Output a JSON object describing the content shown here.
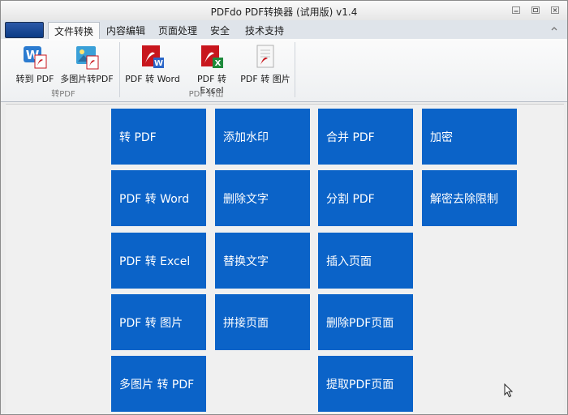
{
  "window": {
    "title": "PDFdo  PDF转换器 (试用版) v1.4"
  },
  "tabs": [
    {
      "label": "文件转换",
      "active": true
    },
    {
      "label": "内容编辑",
      "active": false
    },
    {
      "label": "页面处理",
      "active": false
    },
    {
      "label": "安全",
      "active": false
    },
    {
      "label": "技术支持",
      "active": false
    }
  ],
  "ribbon": {
    "groups": [
      {
        "label": "转PDF",
        "buttons": [
          {
            "label": "转到 PDF",
            "icon": "wps-to-pdf-icon"
          },
          {
            "label": "多图片转PDF",
            "icon": "images-to-pdf-icon"
          }
        ]
      },
      {
        "label": "PDF 转出",
        "buttons": [
          {
            "label": "PDF 转 Word",
            "icon": "pdf-to-word-icon"
          },
          {
            "label": "PDF 转 Excel",
            "icon": "pdf-to-excel-icon"
          },
          {
            "label": "PDF 转 图片",
            "icon": "pdf-to-image-icon"
          }
        ]
      }
    ]
  },
  "tiles": {
    "col1": [
      "转 PDF",
      "PDF 转 Word",
      "PDF 转 Excel",
      "PDF 转 图片",
      "多图片 转 PDF"
    ],
    "col2": [
      "添加水印",
      "删除文字",
      "替换文字",
      "拼接页面"
    ],
    "col3": [
      "合并 PDF",
      "分割 PDF",
      "插入页面",
      "删除PDF页面",
      "提取PDF页面"
    ],
    "col4": [
      "加密",
      "解密去除限制"
    ]
  },
  "colors": {
    "tile": "#0b63c8",
    "app_button": "#0b3c86",
    "pdf_red": "#c8161d"
  }
}
